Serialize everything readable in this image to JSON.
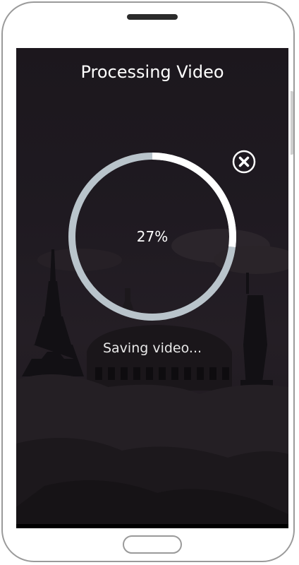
{
  "screen": {
    "title": "Processing Video",
    "progress_percent": 27,
    "progress_label": "27%",
    "status": "Saving video...",
    "close_icon": "close-icon"
  },
  "colors": {
    "ring_track": "#b9c4cb",
    "ring_progress": "#ffffff",
    "overlay": "#1f1a21",
    "text": "#ffffff"
  }
}
